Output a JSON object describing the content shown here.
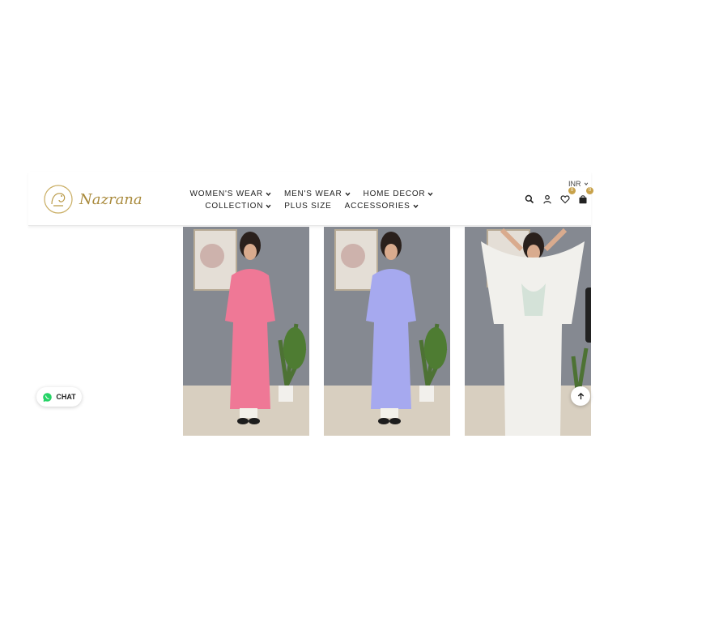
{
  "brand": {
    "name": "Nazrana",
    "color": "#a98a3c"
  },
  "nav": {
    "row1": [
      {
        "label": "WOMEN'S WEAR",
        "dropdown": true
      },
      {
        "label": "MEN'S WEAR",
        "dropdown": true
      },
      {
        "label": "HOME DECOR",
        "dropdown": true
      }
    ],
    "row2": [
      {
        "label": "COLLECTION",
        "dropdown": true
      },
      {
        "label": "PLUS SIZE",
        "dropdown": false
      },
      {
        "label": "ACCESSORIES",
        "dropdown": true
      }
    ]
  },
  "header_tools": {
    "currency": "INR",
    "wishlist_count": "0",
    "cart_count": "0",
    "icons": [
      "search-icon",
      "user-icon",
      "heart-icon",
      "bag-icon"
    ]
  },
  "products": [
    {
      "color": "pink",
      "dress": "#ef7896"
    },
    {
      "color": "lavender",
      "dress": "#a6a9ef"
    },
    {
      "color": "white",
      "dress": "#f1f0ec"
    }
  ],
  "chat": {
    "label": "CHAT",
    "accent": "#25d366"
  }
}
